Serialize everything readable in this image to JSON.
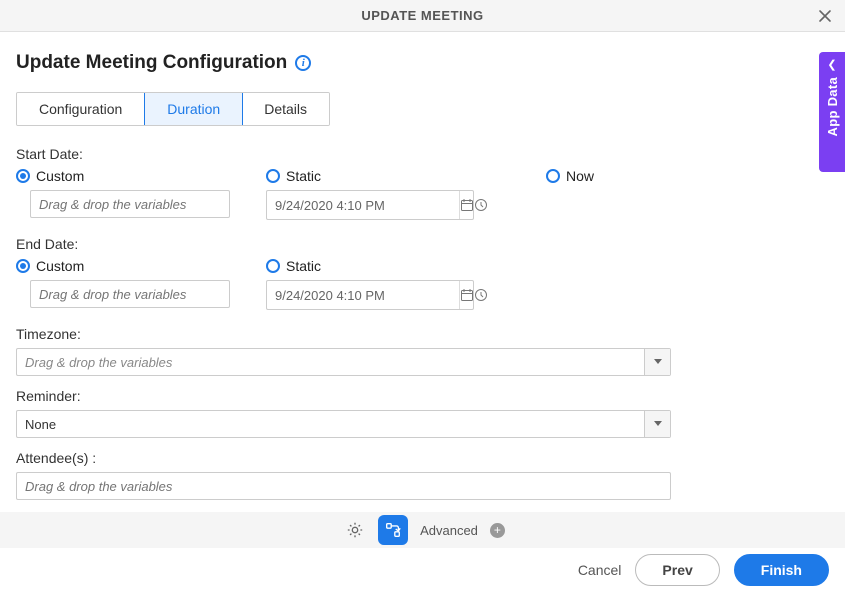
{
  "header": {
    "title": "UPDATE MEETING"
  },
  "page": {
    "title": "Update Meeting Configuration"
  },
  "tabs": {
    "configuration": "Configuration",
    "duration": "Duration",
    "details": "Details"
  },
  "startDate": {
    "label": "Start Date:",
    "custom": "Custom",
    "static": "Static",
    "now": "Now",
    "placeholder": "Drag & drop the variables",
    "staticValue": "9/24/2020 4:10 PM"
  },
  "endDate": {
    "label": "End Date:",
    "custom": "Custom",
    "static": "Static",
    "placeholder": "Drag & drop the variables",
    "staticValue": "9/24/2020 4:10 PM"
  },
  "timezone": {
    "label": "Timezone:",
    "placeholder": "Drag & drop the variables"
  },
  "reminder": {
    "label": "Reminder:",
    "value": "None"
  },
  "attendees": {
    "label": "Attendee(s) :",
    "placeholder": "Drag & drop the variables"
  },
  "sideTab": {
    "label": "App Data"
  },
  "toolbar": {
    "advanced": "Advanced"
  },
  "footer": {
    "cancel": "Cancel",
    "prev": "Prev",
    "finish": "Finish"
  }
}
